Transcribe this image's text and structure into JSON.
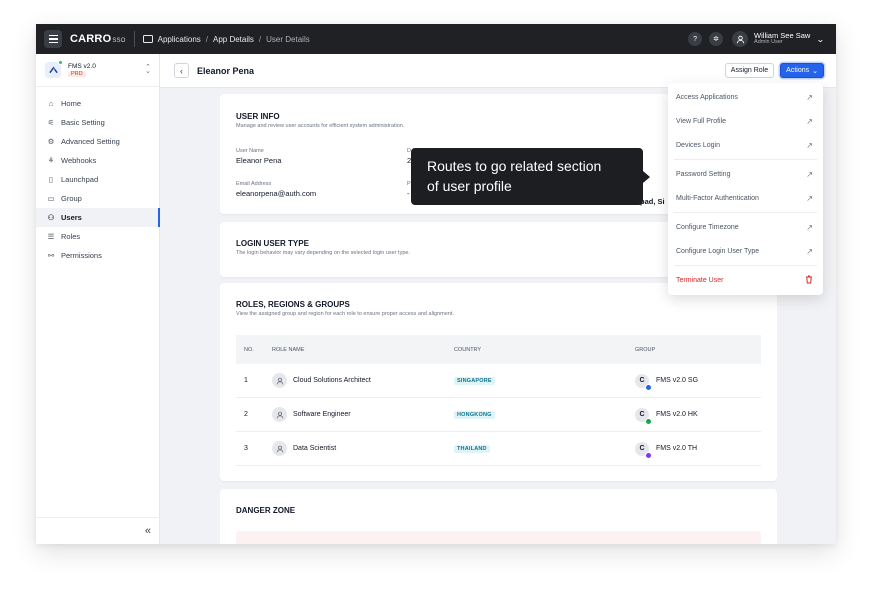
{
  "topbar": {
    "brand": "CARRO",
    "brand_suffix": "SSO",
    "breadcrumbs": [
      "Applications",
      "App Details",
      "User Details"
    ],
    "user_name": "William See Saw",
    "user_role": "Admin User"
  },
  "sidebar": {
    "app_name": "FMS v2.0",
    "app_env": "PRD",
    "items": [
      {
        "label": "Home",
        "icon": "home-icon"
      },
      {
        "label": "Basic Setting",
        "icon": "sliders-icon"
      },
      {
        "label": "Advanced Setting",
        "icon": "gear-icon"
      },
      {
        "label": "Webhooks",
        "icon": "webhook-icon"
      },
      {
        "label": "Launchpad",
        "icon": "launchpad-icon"
      },
      {
        "label": "Group",
        "icon": "group-icon"
      },
      {
        "label": "Users",
        "icon": "users-icon"
      },
      {
        "label": "Roles",
        "icon": "roles-icon"
      },
      {
        "label": "Permissions",
        "icon": "permissions-icon"
      }
    ],
    "active": "Users"
  },
  "header": {
    "title": "Eleanor Pena",
    "assign_label": "Assign Role",
    "actions_label": "Actions"
  },
  "user_info": {
    "title": "USER INFO",
    "desc": "Manage and review user accounts for efficient system administration.",
    "username_label": "User Name",
    "username_value": "Eleanor Pena",
    "email_label": "Email Address",
    "email_value": "eleanorpena@auth.com",
    "col2_label_partial": "D",
    "col2_value_partial": "2",
    "col3_label_partial": "P",
    "col3_value_partial": "-",
    "col4_value_partial": "pad, Si"
  },
  "login_type": {
    "title": "LOGIN USER TYPE",
    "desc": "The login behavior may vary depending on the selected login user type."
  },
  "roles": {
    "title": "ROLES, REGIONS & GROUPS",
    "desc": "View the assigned group and region for each role to ensure proper access and alignment.",
    "columns": [
      "NO.",
      "ROLE NAME",
      "COUNTRY",
      "GROUP"
    ],
    "rows": [
      {
        "no": "1",
        "role": "Cloud Solutions Architect",
        "country": "SINGAPORE",
        "group": "FMS v2.0 SG",
        "badge": "#2563eb"
      },
      {
        "no": "2",
        "role": "Software Engineer",
        "country": "HONGKONG",
        "group": "FMS v2.0 HK",
        "badge": "#16a34a"
      },
      {
        "no": "3",
        "role": "Data Scientist",
        "country": "THAILAND",
        "group": "FMS v2.0 TH",
        "badge": "#7c3aed"
      }
    ]
  },
  "danger": {
    "title": "DANGER ZONE"
  },
  "dropdown": {
    "items": [
      {
        "label": "Access Applications",
        "group": 1
      },
      {
        "label": "View Full Profile",
        "group": 1
      },
      {
        "label": "Devices Login",
        "group": 1
      },
      {
        "label": "Password Setting",
        "group": 2
      },
      {
        "label": "Multi-Factor Authentication",
        "group": 2
      },
      {
        "label": "Configure Timezone",
        "group": 3
      },
      {
        "label": "Configure Login User Type",
        "group": 3
      },
      {
        "label": "Terminate User",
        "group": 4
      }
    ]
  },
  "tooltip": {
    "line1": "Routes to go related section",
    "line2": "of user profile"
  },
  "colors": {
    "accent": "#2563eb",
    "danger": "#dc2626",
    "topbar": "#1f2125"
  }
}
